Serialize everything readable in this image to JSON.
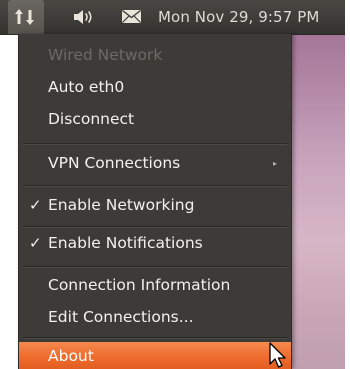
{
  "panel": {
    "clock": "Mon Nov 29,  9:57 PM",
    "icons": [
      "network-icon",
      "volume-icon",
      "mail-icon"
    ]
  },
  "menu": {
    "wired_header": "Wired Network",
    "auto_eth0": "Auto eth0",
    "disconnect": "Disconnect",
    "vpn": "VPN Connections",
    "enable_networking": "Enable Networking",
    "enable_notifications": "Enable Notifications",
    "connection_info": "Connection Information",
    "edit_connections": "Edit Connections...",
    "about": "About",
    "check_glyph": "✓",
    "submenu_arrow": "▸"
  },
  "colors": {
    "highlight": "#ef6d2f",
    "panel_bg": "#3c3b37",
    "disabled_text": "#6d6a64"
  }
}
